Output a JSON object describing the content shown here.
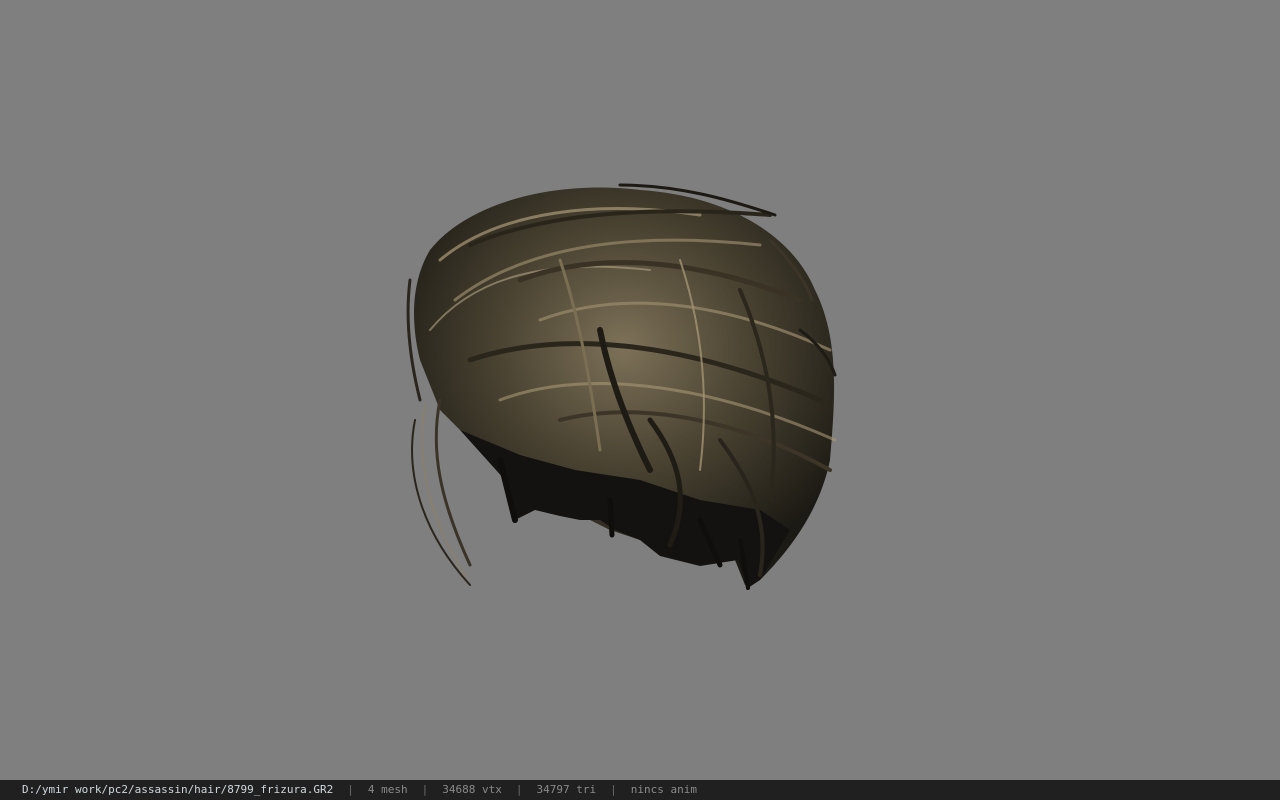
{
  "viewer": {
    "background_color": "#7f7f7f",
    "model": "hair-mesh",
    "hair_colors": {
      "dark": "#1c1a14",
      "mid": "#4a4332",
      "light": "#a99a78"
    }
  },
  "statusbar": {
    "file_path": "D:/ymir work/pc2/assassin/hair/8799_frizura.GR2",
    "separator": "|",
    "mesh": "4 mesh",
    "vtx": "34688 vtx",
    "tri": "34797 tri",
    "anim": "nincs anim"
  }
}
